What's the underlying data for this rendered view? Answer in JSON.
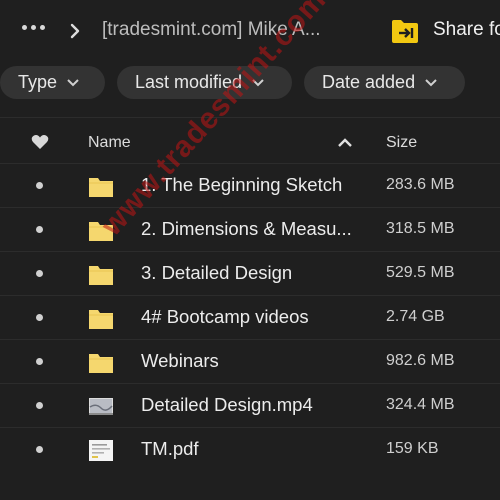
{
  "topbar": {
    "more_icon": "more-horizontal-icon",
    "chevron_icon": "chevron-right-icon",
    "breadcrumb": "[tradesmint.com] Mike A...",
    "share_icon": "shared-folder-icon",
    "share_label": "Share fo"
  },
  "filters": {
    "type_label": "Type",
    "modified_label": "Last modified",
    "added_label": "Date added"
  },
  "columns": {
    "favorite_icon": "heart-icon",
    "name": "Name",
    "sort_icon": "chevron-up-icon",
    "size": "Size"
  },
  "files": [
    {
      "name": "1. The Beginning Sketch",
      "size": "283.6 MB",
      "kind": "folder"
    },
    {
      "name": "2. Dimensions & Measu...",
      "size": "318.5 MB",
      "kind": "folder"
    },
    {
      "name": "3. Detailed Design",
      "size": "529.5 MB",
      "kind": "folder"
    },
    {
      "name": "4# Bootcamp videos",
      "size": "2.74 GB",
      "kind": "folder"
    },
    {
      "name": "Webinars",
      "size": "982.6 MB",
      "kind": "folder"
    },
    {
      "name": "Detailed Design.mp4",
      "size": "324.4 MB",
      "kind": "video"
    },
    {
      "name": "TM.pdf",
      "size": "159 KB",
      "kind": "pdf"
    }
  ],
  "watermark": "www.tradesmint.com",
  "colors": {
    "background": "#1f1f1f",
    "folder": "#f5d76e",
    "share_icon": "#f2c811"
  }
}
